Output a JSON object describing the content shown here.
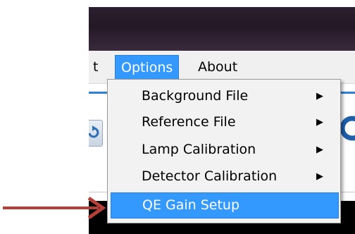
{
  "menubar": {
    "partial_label": "t",
    "options_label": "Options",
    "about_label": "About"
  },
  "options_menu": {
    "items": [
      {
        "label": "Background File",
        "submenu": true
      },
      {
        "label": "Reference File",
        "submenu": true
      },
      {
        "label": "Lamp Calibration",
        "submenu": true
      },
      {
        "label": "Detector Calibration",
        "submenu": true
      },
      {
        "label": "QE Gain Setup",
        "submenu": false,
        "highlighted": true
      }
    ]
  },
  "colors": {
    "highlight": "#3399ff",
    "titlebar": "#241826",
    "annotation_arrow": "#b5403a"
  }
}
